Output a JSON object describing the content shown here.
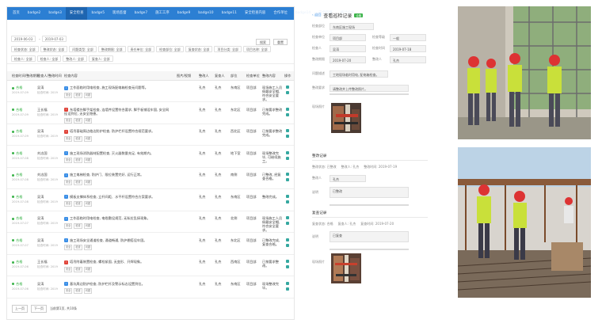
{
  "nav": [
    "首页",
    "badge2",
    "badge3",
    "安全检查",
    "badge5",
    "现场监督",
    "badge7",
    "施工工序",
    "badge9",
    "badge10",
    "badge11",
    "安全检查内容",
    "合作单位",
    "badge14",
    "安全监督",
    "统计分析"
  ],
  "filters": {
    "date_from": "2019-06-03",
    "date_to": "2019-07-03",
    "row1": [
      "检查状态: 全部",
      "整改状态: 全部",
      "问题类型: 全部",
      "整改期限: 全部",
      "责任单位: 全部",
      "检查部位: 全部",
      "复查状态: 全部",
      "项目分类: 全部",
      "项目名称: 全部"
    ],
    "row2": [
      "检查人: 全部",
      "检查人: 全部",
      "整改人: 全部",
      "复查人: 全部"
    ],
    "search": "搜索",
    "reset": "重置"
  },
  "table": {
    "headers": [
      "检查时间/整改期限",
      "检查人/整改时间",
      "检查内容",
      "图片/视频",
      "整改人",
      "复查人",
      "部位",
      "检查单位",
      "整改内容",
      "操作"
    ],
    "rows": [
      {
        "status": "合格",
        "date": "2019-07-09",
        "checker": "吴涛",
        "sub": "检查时间: 2019",
        "badge": "blue",
        "content": "工作面临时用电检查, 施工现场配电箱检查无问题等。",
        "tags": [
          "安全",
          "检查",
          "问题"
        ],
        "person": "孔杰",
        "rechecker": "孔杰",
        "location": "东南区",
        "unit": "项目部",
        "note": "现场施工人员佩戴安全帽, 符合安全要求。"
      },
      {
        "status": "合格",
        "date": "2019-07-09",
        "checker": "王长福",
        "sub": "检查时间: 2019",
        "badge": "red",
        "content": "东塔楼外脚手架检查, 连墙件设置符合要求, 脚手板铺设牢固, 安全网挂设到位, 无安全隐患。",
        "tags": [
          "安全",
          "检查",
          "问题"
        ],
        "person": "孔杰",
        "rechecker": "孔杰",
        "location": "东北区",
        "unit": "项目部",
        "note": "已按要求整改完成。"
      },
      {
        "status": "合格",
        "date": "2019-07-09",
        "checker": "吴涛",
        "sub": "检查时间: 2019",
        "badge": "red",
        "content": "塔吊基础周边临边防护检查, 防护栏杆设置符合规范要求。",
        "tags": [
          "安全",
          "检查",
          "问题"
        ],
        "person": "孔杰",
        "rechecker": "孔杰",
        "location": "西北区",
        "unit": "项目部",
        "note": "已按要求整改完成。"
      },
      {
        "status": "合格",
        "date": "2019-07-08",
        "checker": "刘志国",
        "sub": "检查时间: 2019",
        "badge": "blue",
        "content": "施工现场消防器材配置检查, 灭火器数量充足, 有效期内。",
        "tags": [
          "安全",
          "检查",
          "问题"
        ],
        "person": "孔杰",
        "rechecker": "孔杰",
        "location": "地下室",
        "unit": "项目部",
        "note": "现场整改完毕, 可继续施工。"
      },
      {
        "status": "合格",
        "date": "2019-07-08",
        "checker": "刘志国",
        "sub": "检查时间: 2019",
        "badge": "blue",
        "content": "施工电梯检查, 防护门、限位装置完好, 运行正常。",
        "tags": [
          "安全",
          "检查",
          "问题"
        ],
        "person": "孔杰",
        "rechecker": "孔杰",
        "location": "南侧",
        "unit": "项目部",
        "note": "已整改, 经复查合格。"
      },
      {
        "status": "合格",
        "date": "2019-07-08",
        "checker": "吴涛",
        "sub": "检查时间: 2019",
        "badge": "blue",
        "content": "模板支撑体系检查, 立杆间距、水平杆设置符合方案要求。",
        "tags": [
          "安全",
          "检查",
          "问题"
        ],
        "person": "孔杰",
        "rechecker": "孔杰",
        "location": "东南区",
        "unit": "项目部",
        "note": "整改完成。"
      },
      {
        "status": "合格",
        "date": "2019-07-07",
        "checker": "吴涛",
        "sub": "检查时间: 2019",
        "badge": "blue",
        "content": "工作面临时用电检查, 电缆敷设规范, 无私拉乱接现象。",
        "tags": [
          "安全",
          "检查",
          "问题"
        ],
        "person": "孔杰",
        "rechecker": "孔杰",
        "location": "北侧",
        "unit": "项目部",
        "note": "现场施工人员佩戴安全帽, 符合安全要求。"
      },
      {
        "status": "合格",
        "date": "2019-07-07",
        "checker": "吴涛",
        "sub": "检查时间: 2019",
        "badge": "blue",
        "content": "施工现场安全通道检查, 通道畅通, 防护棚搭设牢固。",
        "tags": [
          "安全",
          "检查",
          "问题"
        ],
        "person": "孔杰",
        "rechecker": "孔杰",
        "location": "东北区",
        "unit": "项目部",
        "note": "已整改完成, 复查合格。"
      },
      {
        "status": "合格",
        "date": "2019-07-06",
        "checker": "王长福",
        "sub": "检查时间: 2019",
        "badge": "red",
        "content": "塔吊附着装置检查, 螺栓紧固, 无变形、开焊现象。",
        "tags": [
          "安全",
          "检查",
          "问题"
        ],
        "person": "孔杰",
        "rechecker": "孔杰",
        "location": "西南区",
        "unit": "项目部",
        "note": "已按要求整改。"
      },
      {
        "status": "合格",
        "date": "2019-07-06",
        "checker": "吴涛",
        "sub": "检查时间: 2019",
        "badge": "blue",
        "content": "基坑周边防护检查, 防护栏杆及警示标志设置到位。",
        "tags": [
          "安全",
          "检查",
          "问题"
        ],
        "person": "孔杰",
        "rechecker": "孔杰",
        "location": "东南区",
        "unit": "项目部",
        "note": "现场整改完毕。"
      }
    ]
  },
  "pager": {
    "prev": "上一页",
    "next": "下一页",
    "info": "当前第1页, 共10条"
  },
  "detail": {
    "back": "返回",
    "title": "查看巡检记录",
    "badge": "合格",
    "fields": [
      {
        "label": "检查部位",
        "value": "东南区施工现场"
      },
      {
        "label": "检查单位",
        "value": "项目部",
        "label2": "检查等级",
        "value2": "一般"
      },
      {
        "label": "检查人",
        "value": "吴涛",
        "label2": "检查时间",
        "value2": "2019-07-18"
      },
      {
        "label": "整改期限",
        "value": "2019-07-20",
        "label2": "整改人",
        "value2": "孔杰"
      }
    ],
    "problem_label": "问题描述",
    "problem": "工地现场临时用电, 配电箱检查。",
    "req_label": "整改要求",
    "req": "请整改并上传整改照片。",
    "photo_label": "现场照片",
    "section2": "整改记录",
    "s2_fields": [
      "整改状态: 已整改",
      "整改人: 孔杰",
      "整改时间: 2019-07-19"
    ],
    "s2_person_label": "整改人",
    "s2_person": "孔杰",
    "s2_desc_label": "说明",
    "s2_desc": "已整改",
    "section3": "复查记录",
    "s3_fields": [
      "复查状态: 合格",
      "复查人: 孔杰",
      "复查时间: 2019-07-20"
    ],
    "s3_desc_label": "说明",
    "s3_desc": "已复查",
    "s3_photo_label": "现场照片"
  }
}
